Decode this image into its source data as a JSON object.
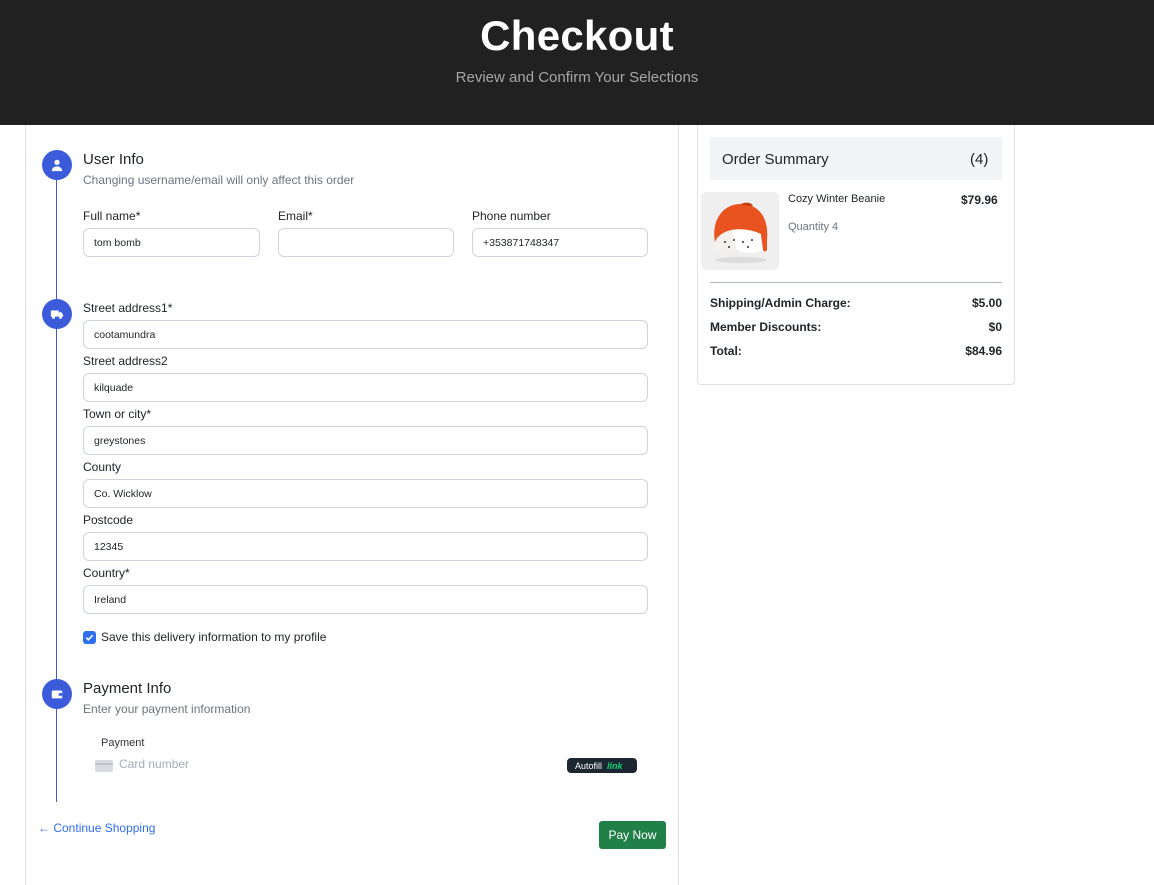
{
  "header": {
    "title": "Checkout",
    "subtitle": "Review and Confirm Your Selections"
  },
  "user_info": {
    "title": "User Info",
    "subtitle": "Changing username/email will only affect this order",
    "fields": {
      "full_name": {
        "label": "Full name*",
        "value": "tom bomb"
      },
      "email": {
        "label": "Email*",
        "value": ""
      },
      "phone": {
        "label": "Phone number",
        "value": "+353871748347"
      }
    }
  },
  "delivery": {
    "fields": {
      "street1": {
        "label": "Street address1*",
        "value": "cootamundra"
      },
      "street2": {
        "label": "Street address2",
        "value": "kilquade"
      },
      "town": {
        "label": "Town or city*",
        "value": "greystones"
      },
      "county": {
        "label": "County",
        "value": "Co. Wicklow"
      },
      "postcode": {
        "label": "Postcode",
        "value": "12345"
      },
      "country": {
        "label": "Country*",
        "value": "Ireland"
      }
    },
    "save_label": "Save this delivery information to my profile",
    "save_checked": true
  },
  "payment": {
    "title": "Payment Info",
    "subtitle": "Enter your payment information",
    "label": "Payment",
    "card_placeholder": "Card number",
    "autofill_label": "Autofill",
    "autofill_brand": "link"
  },
  "actions": {
    "continue_label": "Continue Shopping",
    "pay_label": "Pay Now"
  },
  "order_summary": {
    "title": "Order Summary",
    "count": "(4)",
    "items": [
      {
        "name": "Cozy Winter Beanie",
        "quantity": "Quantity 4",
        "price": "$79.96"
      }
    ],
    "shipping_label": "Shipping/Admin Charge:",
    "shipping_value": "$5.00",
    "discount_label": "Member Discounts:",
    "discount_value": "$0",
    "total_label": "Total:",
    "total_value": "$84.96"
  },
  "colors": {
    "accent": "#3b5bdb",
    "pay_button": "#218048",
    "header_bg": "#212121",
    "link": "#2f6fed"
  }
}
